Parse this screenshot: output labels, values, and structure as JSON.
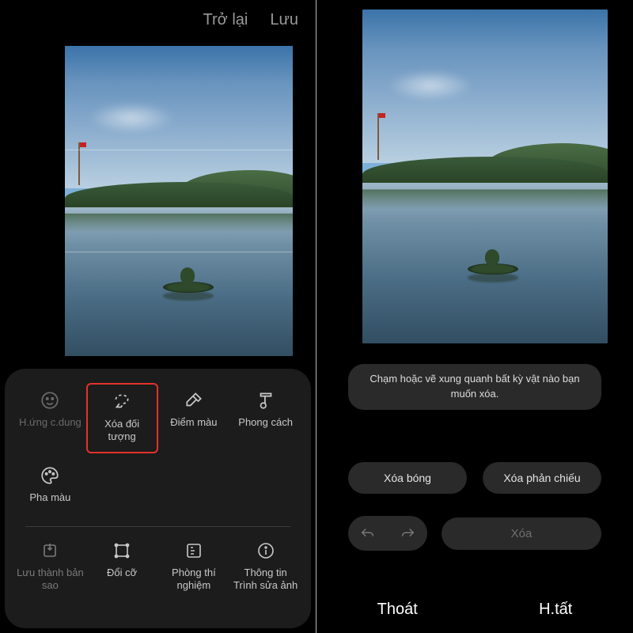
{
  "left": {
    "topbar": {
      "back": "Trở lại",
      "save": "Lưu"
    },
    "tools": {
      "portrait": "H.ứng c.dung",
      "object": "Xóa đối tượng",
      "spot": "Điểm màu",
      "style": "Phong cách",
      "colormix": "Pha màu"
    },
    "bottom": {
      "savecopy": "Lưu thành bản sao",
      "resize": "Đổi cỡ",
      "lab": "Phòng thí nghiệm",
      "info": "Thông tin Trình sửa ảnh"
    }
  },
  "right": {
    "hint": "Chạm hoặc vẽ xung quanh bất kỳ vật nào bạn muốn xóa.",
    "remove_shadow": "Xóa bóng",
    "remove_reflection": "Xóa phản chiếu",
    "delete": "Xóa",
    "exit": "Thoát",
    "done": "H.tất"
  }
}
